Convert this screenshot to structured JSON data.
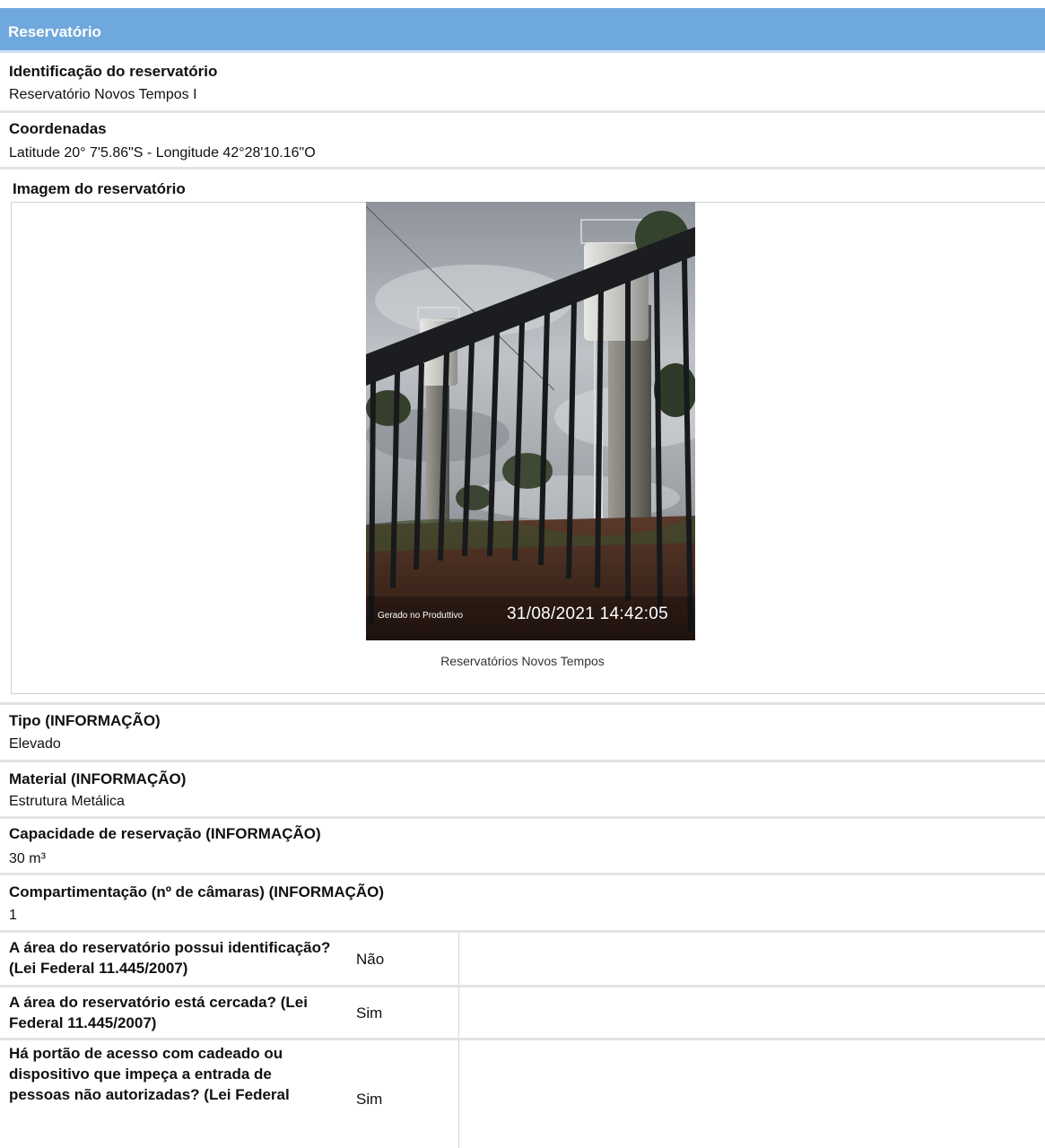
{
  "section": {
    "title": "Reservatório"
  },
  "identificacao": {
    "label": "Identificação do reservatório",
    "value": "Reservatório Novos Tempos I"
  },
  "coordenadas": {
    "label": "Coordenadas",
    "value": "Latitude 20° 7'5.86\"S - Longitude 42°28'10.16\"O"
  },
  "imagem": {
    "label": "Imagem do reservatório",
    "watermark_app": "Gerado no Produttivo",
    "watermark_datetime": "31/08/2021 14:42:05",
    "caption": "Reservatórios Novos Tempos"
  },
  "tipo": {
    "label": "Tipo (INFORMAÇÃO)",
    "value": "Elevado"
  },
  "material": {
    "label": "Material (INFORMAÇÃO)",
    "value": "Estrutura Metálica"
  },
  "capacidade": {
    "label": "Capacidade de reservação (INFORMAÇÃO)",
    "value": "30 m³"
  },
  "compartimentacao": {
    "label": "Compartimentação (nº de câmaras) (INFORMAÇÃO)",
    "value": "1"
  },
  "questions": [
    {
      "question": "A área do reservatório possui identificação? (Lei Federal 11.445/2007)",
      "answer": "Não"
    },
    {
      "question": "A área do reservatório está cercada? (Lei Federal 11.445/2007)",
      "answer": "Sim"
    },
    {
      "question": "Há portão de acesso com cadeado ou dispositivo que impeça a entrada de pessoas não autorizadas? (Lei Federal",
      "answer": "Sim"
    }
  ]
}
